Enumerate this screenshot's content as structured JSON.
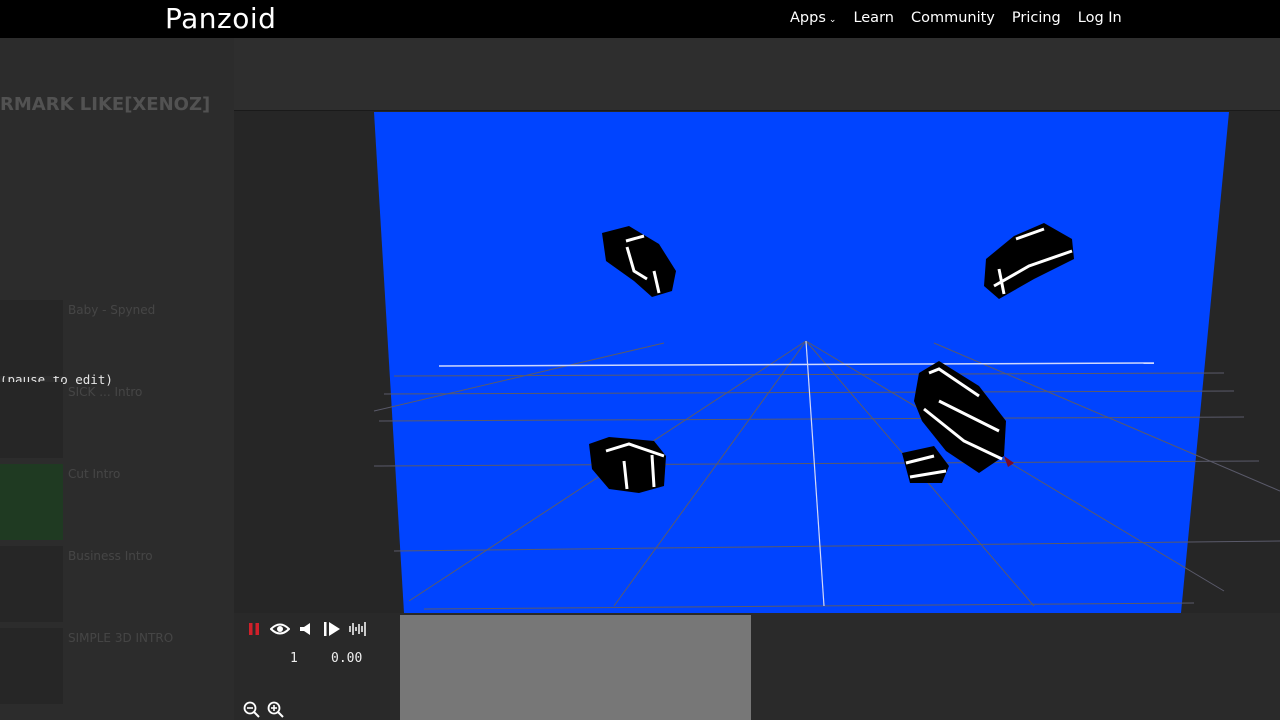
{
  "header": {
    "logo": "Panzoid",
    "nav": [
      {
        "label": "Apps",
        "has_dropdown": true
      },
      {
        "label": "Learn"
      },
      {
        "label": "Community"
      },
      {
        "label": "Pricing"
      },
      {
        "label": "Log In"
      }
    ]
  },
  "sidebar": {
    "title_fragment": "RMARK LIKE[XENOZ]",
    "edit_hint": "(pause to edit)",
    "related": [
      {
        "line1": "Baby - Spyned"
      },
      {
        "line1": "SICK ... Intro"
      },
      {
        "line1": "Cut Intro"
      },
      {
        "line1": "Business Intro"
      },
      {
        "line1": "SIMPLE 3D INTRO"
      }
    ]
  },
  "viewport": {
    "background_color": "#0044ff",
    "object_color": "#000000",
    "grid_color": "#5a5a6a"
  },
  "timeline": {
    "frame": "1",
    "time": "0.00",
    "controls": [
      "pause-icon",
      "eye-icon",
      "volume-icon",
      "step-forward-icon",
      "waveform-icon"
    ],
    "zoom": [
      "zoom-out-icon",
      "zoom-in-icon"
    ],
    "accent_color": "#d0202a"
  }
}
